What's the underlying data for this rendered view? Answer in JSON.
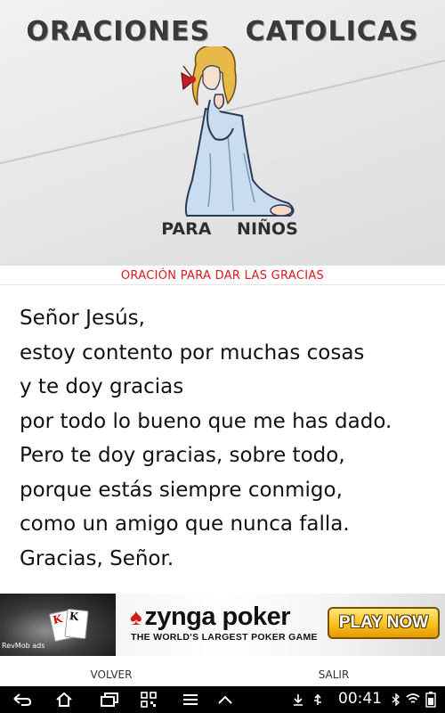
{
  "header": {
    "title": "ORACIONES   CATOLICAS",
    "subtitle": "PARA  NIÑOS"
  },
  "prayer": {
    "title": "ORACIÓN PARA DAR LAS GRACIAS",
    "lines": [
      "Señor Jesús,",
      "estoy contento por muchas cosas",
      "y te doy gracias",
      "por todo lo bueno que me has dado.",
      "Pero te doy gracias, sobre todo,",
      "porque estás siempre conmigo,",
      "como un amigo que nunca falla.",
      "Gracias, Señor."
    ]
  },
  "ad": {
    "brand": "zyngapoker",
    "brand_z": "♠",
    "brand_text": "zynga poker",
    "tagline": "THE WORLD'S LARGEST POKER GAME",
    "cta": "PLAY NOW",
    "network": "RevMob ads",
    "card1": "K",
    "card2": "K"
  },
  "buttons": {
    "back": "VOLVER",
    "exit": "SALIR"
  },
  "status": {
    "time": "00:41"
  },
  "colors": {
    "prayer_title": "#e01818",
    "ad_cta": "#f7c21a"
  }
}
